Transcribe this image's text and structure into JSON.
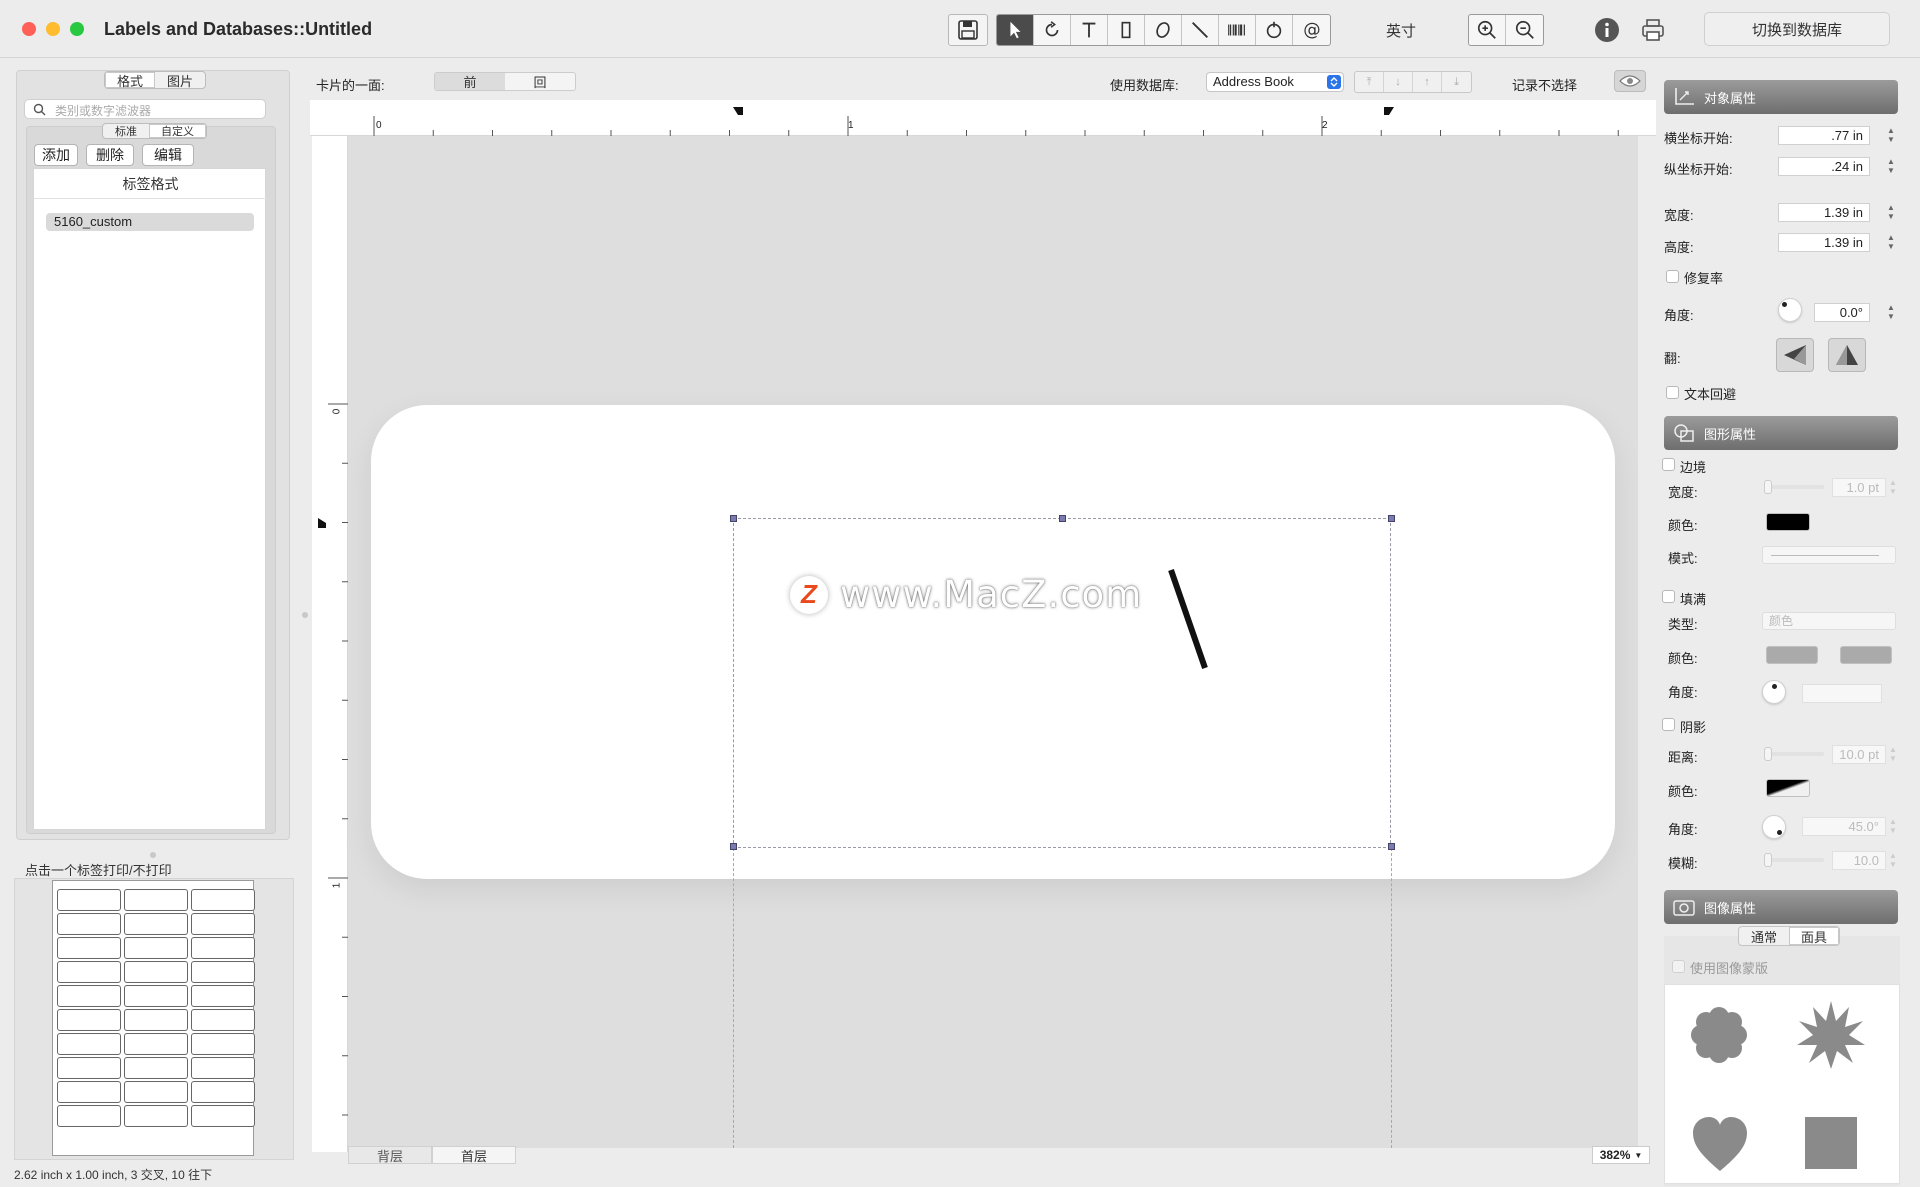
{
  "window": {
    "title": "Labels and  Databases::Untitled",
    "traffic_colors": [
      "#fe5f57",
      "#febc2e",
      "#28c840"
    ]
  },
  "toolbar": {
    "tools": [
      "save-icon",
      "arrow-pointer-icon",
      "rotate-icon",
      "text-tool-icon",
      "rectangle-icon",
      "ellipse-icon",
      "line-icon",
      "barcode-icon",
      "image-tool-icon",
      "at-sign-icon"
    ],
    "unit_label": "英寸",
    "zoom_in": "zoom-in-icon",
    "zoom_out": "zoom-out-icon",
    "info": "info-icon",
    "print": "printer-icon",
    "switch_db_label": "切换到数据库"
  },
  "left": {
    "tabs": [
      "格式",
      "图片"
    ],
    "selected_tab": "格式",
    "search_placeholder": "类别或数字滤波器",
    "sub_tabs": [
      "标准",
      "自定义"
    ],
    "selected_sub_tab": "自定义",
    "add_label": "添加",
    "delete_label": "删除",
    "edit_label": "编辑",
    "list_header": "标签格式",
    "list_items": [
      "5160_custom"
    ],
    "print_hint": "点击一个标签打印/不打印",
    "sheet": {
      "cols": 3,
      "rows": 10
    }
  },
  "status_text": "2.62 inch x 1.00 inch, 3 交叉, 10 往下",
  "center": {
    "card_side_label": "卡片的一面:",
    "sides": [
      "前",
      "回"
    ],
    "selected_side": "前",
    "use_db_label": "使用数据库:",
    "db_value": "Address Book",
    "no_record_label": "记录不选择",
    "hruler_ticks": [
      "0",
      "1",
      "2"
    ],
    "vruler_ticks": [
      "0",
      "1"
    ],
    "watermark_logo": "Z",
    "watermark_text": "www.MacZ.com",
    "layers": [
      "背层",
      "首层"
    ],
    "selected_layer": "首层",
    "zoom": "382%"
  },
  "object_props": {
    "header": "对象属性",
    "x_label": "横坐标开始:",
    "x_value": ".77 in",
    "y_label": "纵坐标开始:",
    "y_value": ".24 in",
    "w_label": "宽度:",
    "w_value": "1.39 in",
    "h_label": "高度:",
    "h_value": "1.39 in",
    "repair_label": "修复率",
    "angle_label": "角度:",
    "angle_value": "0.0°",
    "flip_label": "翻:",
    "text_wrap_label": "文本回避"
  },
  "shape_props": {
    "header": "图形属性",
    "border_label": "边境",
    "border_width_label": "宽度:",
    "border_width_value": "1.0 pt",
    "border_color_label": "颜色:",
    "border_color": "#000000",
    "pattern_label": "模式:",
    "fill_label": "填满",
    "fill_type_label": "类型:",
    "fill_type_value": "颜色",
    "fill_color_label": "颜色:",
    "fill_angle_label": "角度:",
    "shadow_label": "阴影",
    "shadow_dist_label": "距离:",
    "shadow_dist_value": "10.0 pt",
    "shadow_color_label": "颜色:",
    "shadow_angle_label": "角度:",
    "shadow_angle_value": "45.0°",
    "shadow_blur_label": "模糊:",
    "shadow_blur_value": "10.0"
  },
  "image_props": {
    "header": "图像属性",
    "tabs": [
      "通常",
      "面具"
    ],
    "selected_tab": "面具",
    "use_mask_label": "使用图像蒙版",
    "masks": [
      "flower-mask-icon",
      "starburst-mask-icon",
      "heart-mask-icon",
      "square-mask-icon"
    ]
  }
}
